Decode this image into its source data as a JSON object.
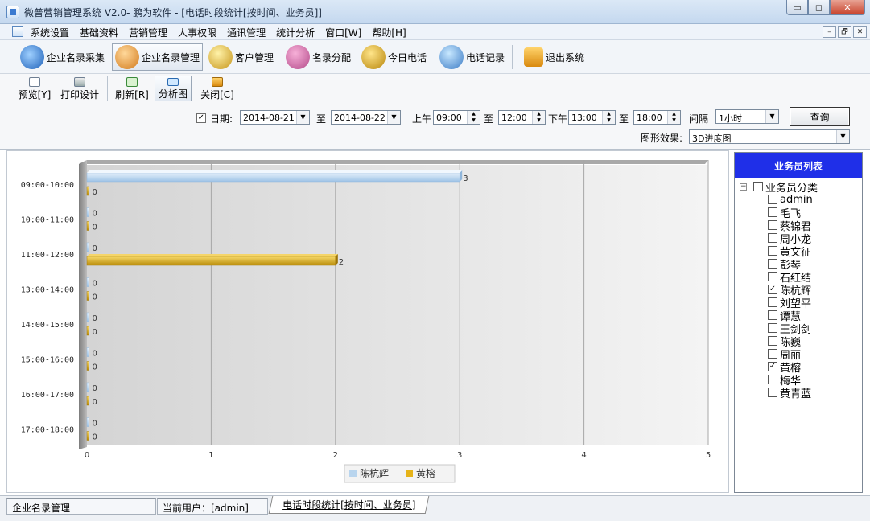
{
  "window": {
    "title": "微普营销管理系统 V2.0- 鹏为软件 - [电话时段统计[按时间、业务员]]",
    "minimize_label": "▭",
    "maximize_label": "◻",
    "close_label": "✕"
  },
  "menubar": {
    "items": [
      "系统设置",
      "基础资料",
      "营销管理",
      "人事权限",
      "通讯管理",
      "统计分析",
      "窗口[W]",
      "帮助[H]"
    ],
    "mdi_min": "–",
    "mdi_restore": "🗗",
    "mdi_close": "✕"
  },
  "toolbar1": {
    "items": [
      "企业名录采集",
      "企业名录管理",
      "客户管理",
      "名录分配",
      "今日电话",
      "电话记录",
      "退出系统"
    ],
    "active_index": 1
  },
  "toolbar2": {
    "items": [
      "预览[Y]",
      "打印设计",
      "刷新[R]",
      "分析图",
      "关闭[C]"
    ],
    "active_index": 3
  },
  "filters": {
    "date_checked": "✓",
    "date_label": "日期:",
    "date_from": "2014-08-21",
    "to1": "至",
    "date_to": "2014-08-22",
    "am_label": "上午",
    "am_from": "09:00",
    "to2": "至",
    "am_to": "12:00",
    "pm_label": "下午",
    "pm_from": "13:00",
    "to3": "至",
    "pm_to": "18:00",
    "interval_label": "间隔",
    "interval_value": "1小时",
    "query_button": "查询",
    "effect_label": "图形效果:",
    "effect_value": "3D进度图"
  },
  "chart_data": {
    "type": "bar",
    "orientation": "horizontal",
    "categories": [
      "09:00-10:00",
      "10:00-11:00",
      "11:00-12:00",
      "13:00-14:00",
      "14:00-15:00",
      "15:00-16:00",
      "16:00-17:00",
      "17:00-18:00"
    ],
    "series": [
      {
        "name": "陈杭辉",
        "color": "#b9d5ee",
        "values": [
          3,
          0,
          0,
          0,
          0,
          0,
          0,
          0
        ]
      },
      {
        "name": "黄榕",
        "color": "#e6b319",
        "values": [
          0,
          0,
          2,
          0,
          0,
          0,
          0,
          0
        ]
      }
    ],
    "xlim": [
      0,
      5
    ],
    "xticks": [
      0,
      1,
      2,
      3,
      4,
      5
    ],
    "grid": true,
    "style": "3D",
    "legend_position": "bottom"
  },
  "sidepanel": {
    "header": "业务员列表",
    "root_label": "业务员分类",
    "expander": "−",
    "items": [
      {
        "label": "admin",
        "checked": ""
      },
      {
        "label": "毛飞",
        "checked": ""
      },
      {
        "label": "蔡锦君",
        "checked": ""
      },
      {
        "label": "周小龙",
        "checked": ""
      },
      {
        "label": "黄文征",
        "checked": ""
      },
      {
        "label": "彭琴",
        "checked": ""
      },
      {
        "label": "石红结",
        "checked": ""
      },
      {
        "label": "陈杭辉",
        "checked": "✓"
      },
      {
        "label": "刘望平",
        "checked": ""
      },
      {
        "label": "谭慧",
        "checked": ""
      },
      {
        "label": "王剑剑",
        "checked": ""
      },
      {
        "label": "陈巍",
        "checked": ""
      },
      {
        "label": "周丽",
        "checked": ""
      },
      {
        "label": "黄榕",
        "checked": "✓"
      },
      {
        "label": "梅华",
        "checked": ""
      },
      {
        "label": "黄青蓝",
        "checked": ""
      }
    ]
  },
  "statusbar": {
    "module": "企业名录管理",
    "user": "当前用户：[admin]",
    "tab": "电话时段统计[按时间、业务员]"
  }
}
